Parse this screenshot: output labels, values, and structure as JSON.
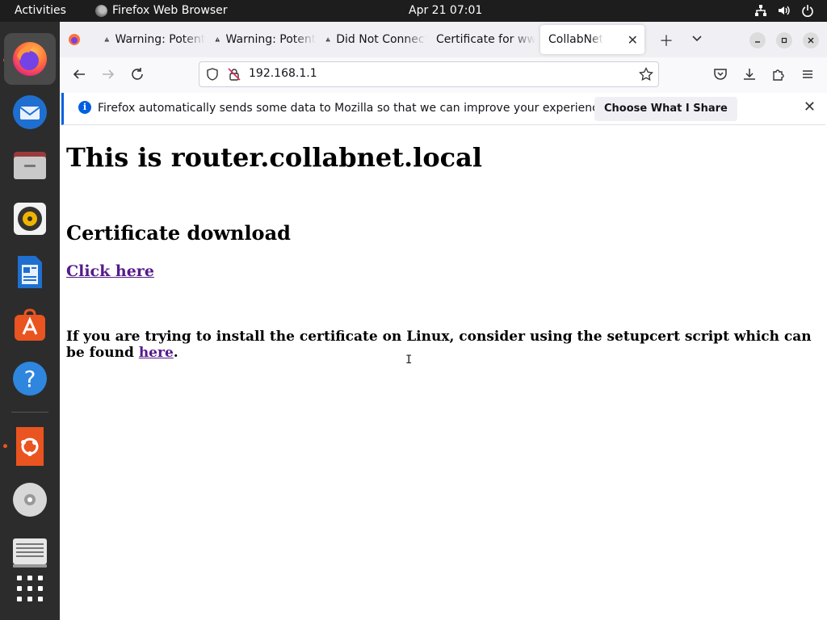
{
  "topbar": {
    "activities": "Activities",
    "app_name": "Firefox Web Browser",
    "clock": "Apr 21  07:01"
  },
  "dock": {
    "items": [
      {
        "name": "firefox-icon",
        "active": true,
        "running": true
      },
      {
        "name": "thunderbird-icon"
      },
      {
        "name": "files-icon"
      },
      {
        "name": "rhythmbox-icon"
      },
      {
        "name": "libreoffice-writer-icon"
      },
      {
        "name": "app-center-icon"
      },
      {
        "name": "help-icon"
      },
      {
        "name": "ubuntu-installer-icon",
        "running": true
      },
      {
        "name": "disc-icon"
      },
      {
        "name": "terminal-icon"
      },
      {
        "name": "show-apps-icon"
      }
    ]
  },
  "tabs": [
    {
      "label": "",
      "icon": "firefox-icon"
    },
    {
      "label": "Warning: Potential Security Risk Ahead",
      "icon": "warning-icon"
    },
    {
      "label": "Warning: Potential Security Risk Ahead",
      "icon": "warning-icon"
    },
    {
      "label": "Did Not Connect: Potential Security Issue",
      "icon": "warning-icon"
    },
    {
      "label": "Certificate for www",
      "icon": ""
    },
    {
      "label": "CollabNet",
      "icon": "",
      "active": true
    }
  ],
  "urlbar": {
    "url": "192.168.1.1"
  },
  "notification": {
    "message": "Firefox automatically sends some data to Mozilla so that we can improve your experience.",
    "button": "Choose What I Share"
  },
  "page": {
    "title": "This is router.collabnet.local",
    "section_heading": "Certificate download",
    "download_link": "Click here",
    "note_before": "If you are trying to install the certificate on Linux, consider using the setupcert script which can be found ",
    "note_link": "here",
    "note_after": "."
  },
  "colors": {
    "accent_blue": "#0060df",
    "ubuntu_orange": "#e95420",
    "visited_link": "#551a8b"
  }
}
